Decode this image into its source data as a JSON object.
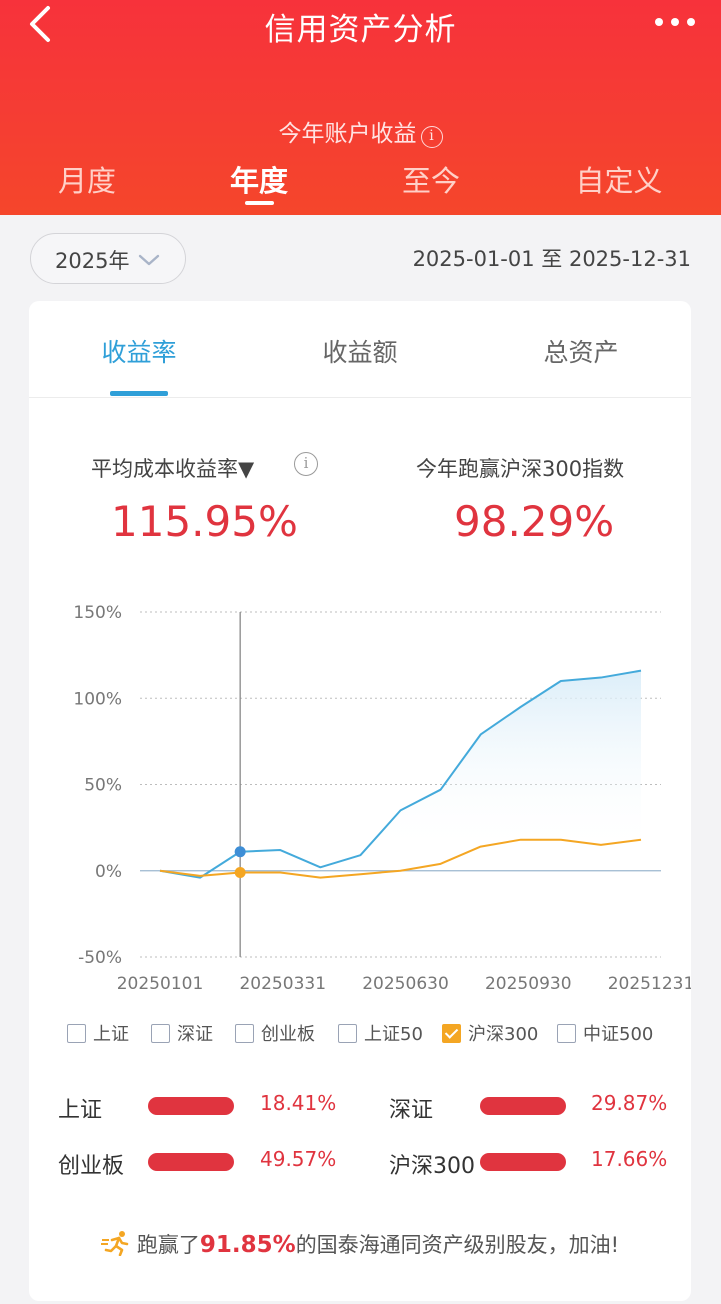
{
  "header": {
    "title": "信用资产分析",
    "subtitle": "今年账户收益",
    "period_tabs": [
      {
        "label": "月度",
        "active": false
      },
      {
        "label": "年度",
        "active": true
      },
      {
        "label": "至今",
        "active": false
      },
      {
        "label": "自定义",
        "active": false
      }
    ]
  },
  "filter": {
    "year": "2025年",
    "date_range": "2025-01-01 至 2025-12-31"
  },
  "metric_tabs": [
    {
      "label": "收益率",
      "active": true
    },
    {
      "label": "收益额",
      "active": false
    },
    {
      "label": "总资产",
      "active": false
    }
  ],
  "metrics": {
    "left_label": "平均成本收益率▼",
    "left_value": "115.95%",
    "right_label": "今年跑赢沪深300指数",
    "right_value": "98.29%"
  },
  "chart_data": {
    "type": "line",
    "y_ticks": [
      "150%",
      "100%",
      "50%",
      "0%",
      "-50%"
    ],
    "ylim": [
      -50,
      150
    ],
    "x_ticks": [
      "20250101",
      "20250331",
      "20250630",
      "20250930",
      "20251231"
    ],
    "grid": true,
    "series": [
      {
        "name": "account",
        "color": "#44aadb",
        "points": [
          [
            0,
            0
          ],
          [
            1,
            -4
          ],
          [
            2,
            11
          ],
          [
            3,
            12
          ],
          [
            4,
            2
          ],
          [
            5,
            9
          ],
          [
            6,
            35
          ],
          [
            7,
            47
          ],
          [
            8,
            79
          ],
          [
            9,
            95
          ],
          [
            10,
            110
          ],
          [
            11,
            112
          ],
          [
            12,
            116
          ]
        ]
      },
      {
        "name": "沪深300",
        "color": "#f4a623",
        "points": [
          [
            0,
            0
          ],
          [
            1,
            -3
          ],
          [
            2,
            -1
          ],
          [
            3,
            -1
          ],
          [
            4,
            -4
          ],
          [
            5,
            -2
          ],
          [
            6,
            0
          ],
          [
            7,
            4
          ],
          [
            8,
            14
          ],
          [
            9,
            18
          ],
          [
            10,
            18
          ],
          [
            11,
            15
          ],
          [
            12,
            18
          ]
        ]
      }
    ],
    "cursor_index": 2,
    "x_max_index": 12
  },
  "legend": [
    {
      "label": "上证",
      "checked": false
    },
    {
      "label": "深证",
      "checked": false
    },
    {
      "label": "创业板",
      "checked": false
    },
    {
      "label": "上证50",
      "checked": false
    },
    {
      "label": "沪深300",
      "checked": true
    },
    {
      "label": "中证500",
      "checked": false
    }
  ],
  "compare": [
    {
      "label": "上证",
      "value": "18.41%"
    },
    {
      "label": "深证",
      "value": "29.87%"
    },
    {
      "label": "创业板",
      "value": "49.57%"
    },
    {
      "label": "沪深300",
      "value": "17.66%"
    }
  ],
  "footer": {
    "prefix": "跑赢了",
    "highlight": "91.85%",
    "suffix": "的国泰海通同资产级别股友，加油!"
  },
  "colors": {
    "header_red": "#f5363a",
    "accent_blue": "#2f9fd8",
    "value_red": "#e0343f",
    "benchmark_orange": "#f4a623"
  }
}
